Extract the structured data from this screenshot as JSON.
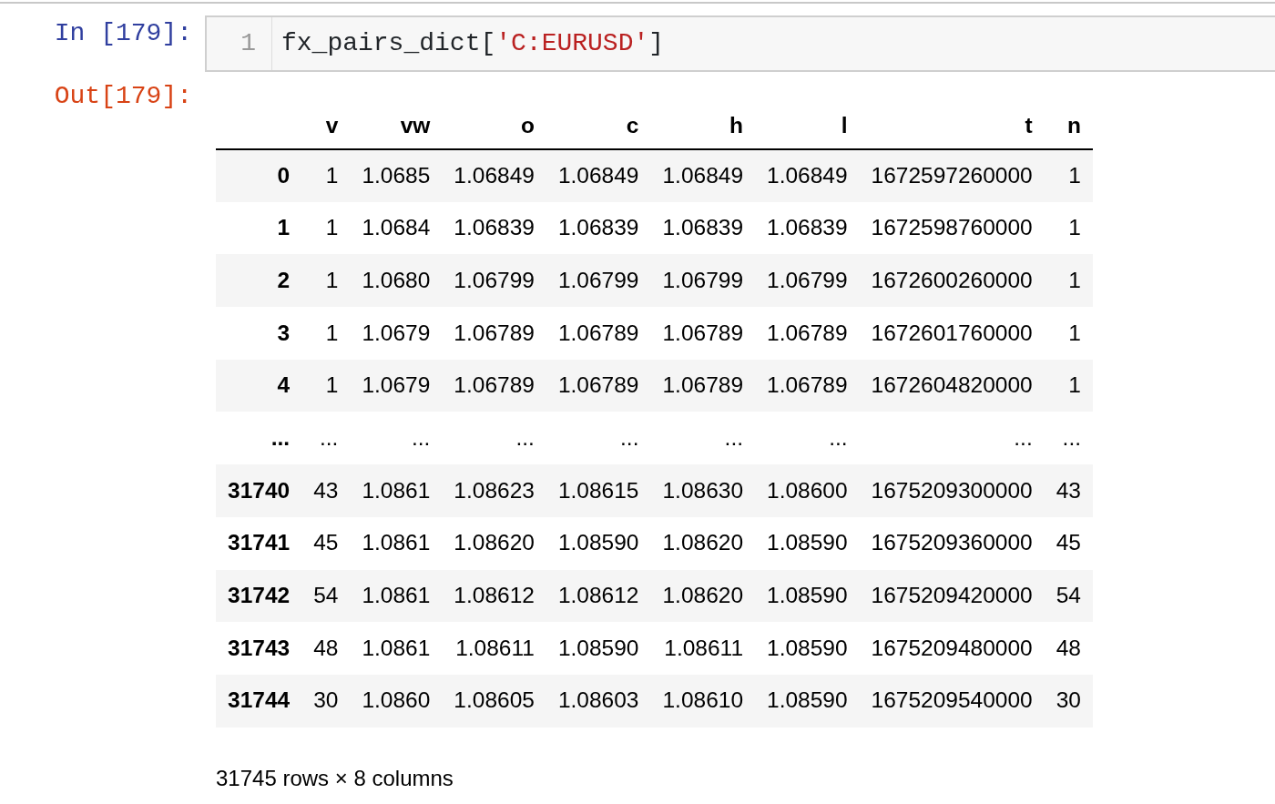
{
  "input_cell": {
    "prompt": "In [179]:",
    "line_number": "1",
    "code": [
      {
        "kind": "name",
        "text": "fx_pairs_dict["
      },
      {
        "kind": "string",
        "text": "'C:EURUSD'"
      },
      {
        "kind": "name",
        "text": "]"
      }
    ]
  },
  "output_cell": {
    "prompt": "Out[179]:",
    "table": {
      "columns": [
        "v",
        "vw",
        "o",
        "c",
        "h",
        "l",
        "t",
        "n"
      ],
      "rows": [
        {
          "index": "0",
          "cells": [
            "1",
            "1.0685",
            "1.06849",
            "1.06849",
            "1.06849",
            "1.06849",
            "1672597260000",
            "1"
          ]
        },
        {
          "index": "1",
          "cells": [
            "1",
            "1.0684",
            "1.06839",
            "1.06839",
            "1.06839",
            "1.06839",
            "1672598760000",
            "1"
          ]
        },
        {
          "index": "2",
          "cells": [
            "1",
            "1.0680",
            "1.06799",
            "1.06799",
            "1.06799",
            "1.06799",
            "1672600260000",
            "1"
          ]
        },
        {
          "index": "3",
          "cells": [
            "1",
            "1.0679",
            "1.06789",
            "1.06789",
            "1.06789",
            "1.06789",
            "1672601760000",
            "1"
          ]
        },
        {
          "index": "4",
          "cells": [
            "1",
            "1.0679",
            "1.06789",
            "1.06789",
            "1.06789",
            "1.06789",
            "1672604820000",
            "1"
          ]
        },
        {
          "index": "...",
          "cells": [
            "...",
            "...",
            "...",
            "...",
            "...",
            "...",
            "...",
            "..."
          ]
        },
        {
          "index": "31740",
          "cells": [
            "43",
            "1.0861",
            "1.08623",
            "1.08615",
            "1.08630",
            "1.08600",
            "1675209300000",
            "43"
          ]
        },
        {
          "index": "31741",
          "cells": [
            "45",
            "1.0861",
            "1.08620",
            "1.08590",
            "1.08620",
            "1.08590",
            "1675209360000",
            "45"
          ]
        },
        {
          "index": "31742",
          "cells": [
            "54",
            "1.0861",
            "1.08612",
            "1.08612",
            "1.08620",
            "1.08590",
            "1675209420000",
            "54"
          ]
        },
        {
          "index": "31743",
          "cells": [
            "48",
            "1.0861",
            "1.08611",
            "1.08590",
            "1.08611",
            "1.08590",
            "1675209480000",
            "48"
          ]
        },
        {
          "index": "31744",
          "cells": [
            "30",
            "1.0860",
            "1.08605",
            "1.08603",
            "1.08610",
            "1.08590",
            "1675209540000",
            "30"
          ]
        }
      ],
      "footer": "31745 rows × 8 columns"
    }
  }
}
